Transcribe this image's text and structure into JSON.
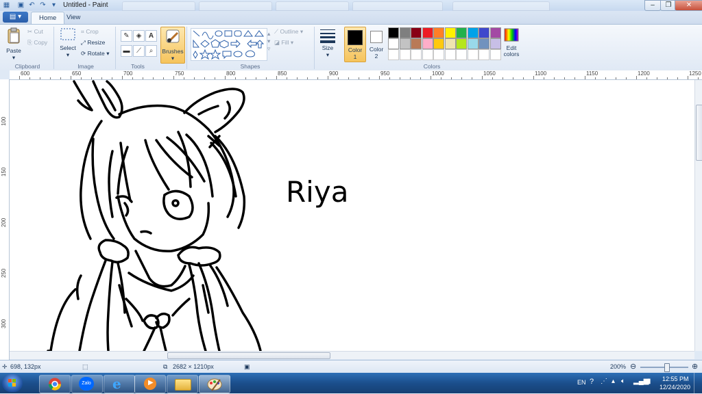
{
  "window": {
    "title": "Untitled - Paint",
    "controls": {
      "minimize": "–",
      "restore": "❐",
      "close": "✕"
    }
  },
  "quick_access": [
    "save-icon",
    "undo-icon",
    "redo-icon",
    "customize-icon"
  ],
  "tabs": {
    "home": "Home",
    "view": "View"
  },
  "ribbon": {
    "clipboard": {
      "group": "Clipboard",
      "paste": "Paste",
      "cut": "Cut",
      "copy": "Copy"
    },
    "image": {
      "group": "Image",
      "select": "Select",
      "crop": "Crop",
      "resize": "Resize",
      "rotate": "Rotate"
    },
    "tools": {
      "group": "Tools"
    },
    "brushes": {
      "label": "Brushes"
    },
    "shapes": {
      "group": "Shapes",
      "outline": "Outline",
      "fill": "Fill"
    },
    "size": {
      "label": "Size"
    },
    "color1": {
      "label": "Color",
      "num": "1",
      "value": "#000000"
    },
    "color2": {
      "label": "Color",
      "num": "2",
      "value": "#ffffff"
    },
    "colors": {
      "group": "Colors",
      "edit": "Edit",
      "edit2": "colors"
    },
    "palette": [
      "#000000",
      "#7f7f7f",
      "#880015",
      "#ed1c24",
      "#ff7f27",
      "#fff200",
      "#22b14c",
      "#00a2e8",
      "#3f48cc",
      "#a349a4",
      "#ffffff",
      "#c3c3c3",
      "#b97a57",
      "#ffaec9",
      "#ffc90e",
      "#efe4b0",
      "#b5e61d",
      "#99d9ea",
      "#7092be",
      "#c8bfe7"
    ]
  },
  "ruler": {
    "x_ticks": [
      "600",
      "650",
      "700",
      "750",
      "800",
      "850",
      "900",
      "950",
      "1000",
      "1050",
      "1100",
      "1150",
      "1200",
      "1250"
    ],
    "y_ticks": [
      "100",
      "150",
      "200",
      "250",
      "300"
    ]
  },
  "canvas": {
    "text": "Riya"
  },
  "status": {
    "cursor": "698, 132px",
    "size": "2682 × 1210px",
    "zoom": "200%"
  },
  "taskbar": {
    "apps": [
      "windows-start-icon",
      "chrome-icon",
      "zalo-icon",
      "ie-icon",
      "media-player-icon",
      "folder-icon",
      "paint-icon"
    ],
    "zalo_label": "Zalo",
    "lang": "EN",
    "time": "12:55 PM",
    "date": "12/24/2020"
  }
}
